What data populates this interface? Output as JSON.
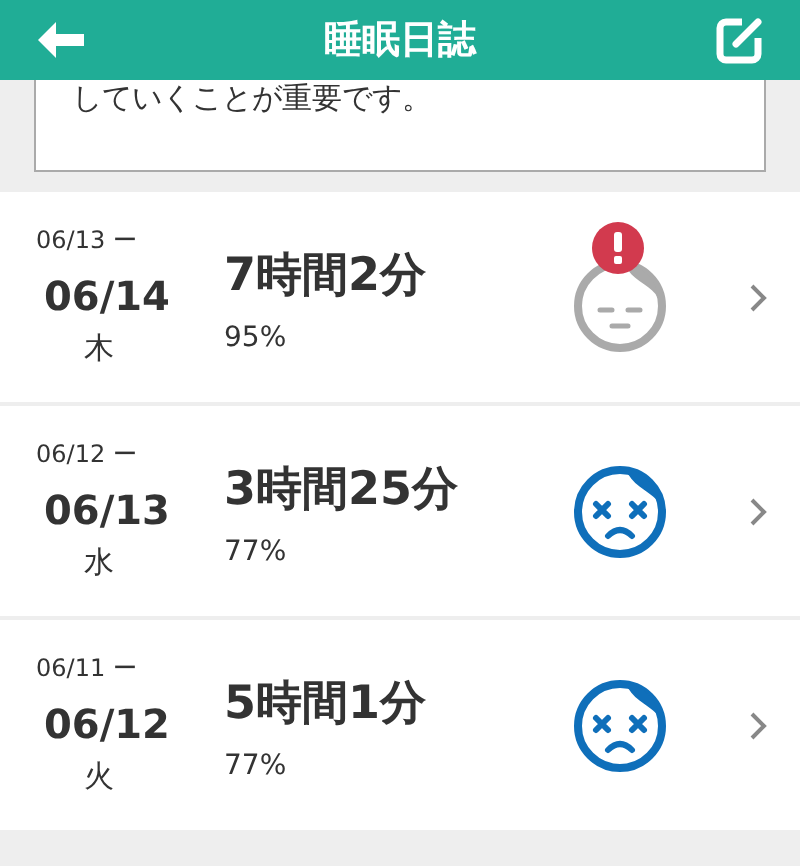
{
  "header": {
    "title": "睡眠日誌"
  },
  "notice": {
    "text": "していくことが重要です。"
  },
  "entries": [
    {
      "from_date": "06/13 ー",
      "date": "06/14",
      "weekday": "木",
      "duration": "7時間2分",
      "efficiency": "95%",
      "kind": "calm",
      "alert": true
    },
    {
      "from_date": "06/12 ー",
      "date": "06/13",
      "weekday": "水",
      "duration": "3時間25分",
      "efficiency": "77%",
      "kind": "dizzy",
      "alert": false
    },
    {
      "from_date": "06/11 ー",
      "date": "06/12",
      "weekday": "火",
      "duration": "5時間1分",
      "efficiency": "77%",
      "kind": "dizzy",
      "alert": false
    }
  ]
}
